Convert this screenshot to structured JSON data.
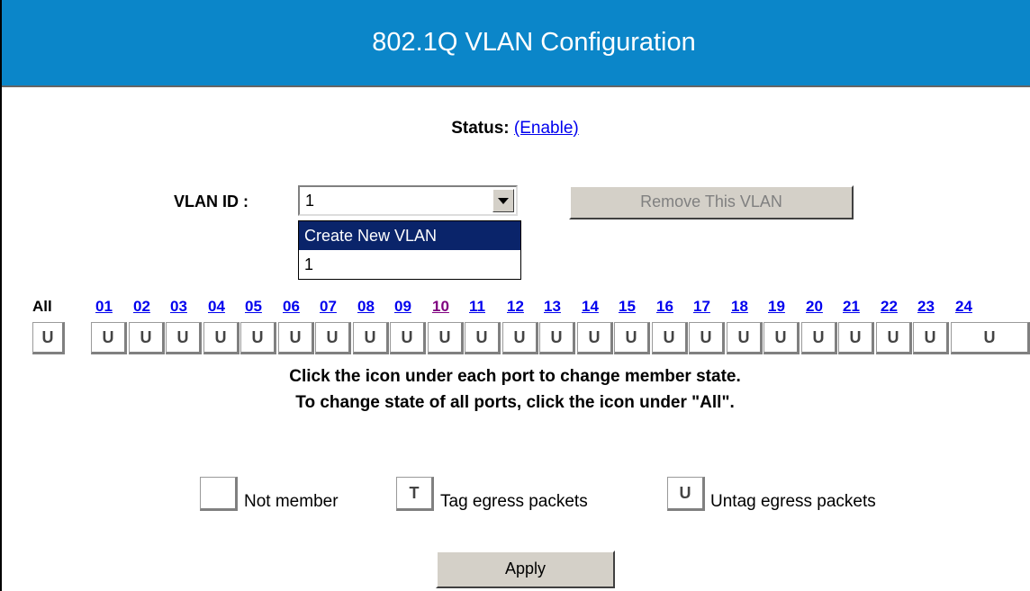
{
  "header": {
    "title": "802.1Q VLAN Configuration"
  },
  "status": {
    "label": "Status:",
    "value": "(Enable)"
  },
  "vlan": {
    "label": "VLAN ID :",
    "selected": "1",
    "options": [
      "Create New VLAN",
      "1"
    ],
    "highlighted": "Create New VLAN",
    "remove_label": "Remove This VLAN"
  },
  "ports": {
    "all_label": "All",
    "all_state": "U",
    "labels": [
      "01",
      "02",
      "03",
      "04",
      "05",
      "06",
      "07",
      "08",
      "09",
      "10",
      "11",
      "12",
      "13",
      "14",
      "15",
      "16",
      "17",
      "18",
      "19",
      "20",
      "21",
      "22",
      "23",
      "24"
    ],
    "states": [
      "U",
      "U",
      "U",
      "U",
      "U",
      "U",
      "U",
      "U",
      "U",
      "U",
      "U",
      "U",
      "U",
      "U",
      "U",
      "U",
      "U",
      "U",
      "U",
      "U",
      "U",
      "U",
      "U",
      "U"
    ],
    "visited": "10"
  },
  "notes": {
    "line1": "Click the icon under each port to change member state.",
    "line2": "To change state of all ports, click the icon under \"All\"."
  },
  "legend": {
    "not_member_label": "Not member",
    "tag_icon": "T",
    "tag_label": "Tag egress packets",
    "untag_icon": "U",
    "untag_label": "Untag egress packets"
  },
  "actions": {
    "apply_label": "Apply"
  },
  "colors": {
    "header_bg": "#0b86c9",
    "link": "#0000ee",
    "visited_link": "#800080"
  }
}
